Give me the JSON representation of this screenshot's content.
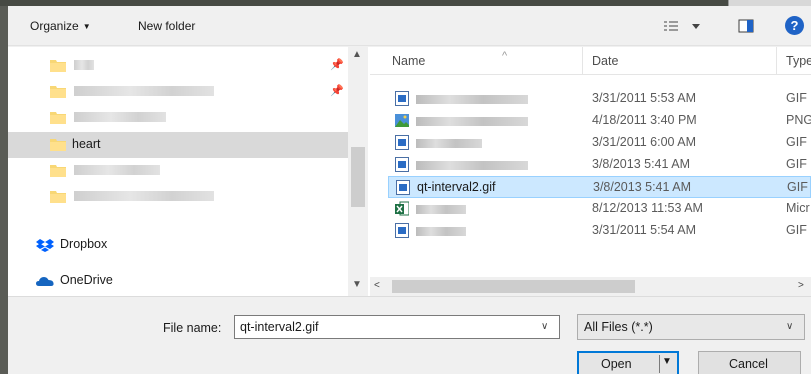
{
  "toolbar": {
    "organize_label": "Organize",
    "new_folder_label": "New folder",
    "help_label": "?"
  },
  "nav": {
    "selected_folder": "heart",
    "dropbox_label": "Dropbox",
    "onedrive_label": "OneDrive"
  },
  "columns": {
    "name": "Name",
    "date": "Date",
    "type": "Type"
  },
  "files": [
    {
      "name": "",
      "date": "3/31/2011 5:53 AM",
      "type": "GIF I",
      "icon": "gif-file-icon"
    },
    {
      "name": "",
      "date": "4/18/2011 3:40 PM",
      "type": "PNG",
      "icon": "png-file-icon"
    },
    {
      "name": "",
      "date": "3/31/2011 6:00 AM",
      "type": "GIF I",
      "icon": "gif-file-icon"
    },
    {
      "name": "",
      "date": "3/8/2013 5:41 AM",
      "type": "GIF I",
      "icon": "gif-file-icon"
    },
    {
      "name": "qt-interval2.gif",
      "date": "3/8/2013 5:41 AM",
      "type": "GIF I",
      "icon": "gif-file-icon",
      "selected": true
    },
    {
      "name": "",
      "date": "8/12/2013 11:53 AM",
      "type": "Micr",
      "icon": "excel-file-icon"
    },
    {
      "name": "",
      "date": "3/31/2011 5:54 AM",
      "type": "GIF I",
      "icon": "gif-file-icon"
    }
  ],
  "bottom": {
    "file_name_label": "File name:",
    "file_name_value": "qt-interval2.gif",
    "filter_value": "All Files (*.*)",
    "open_label": "Open",
    "cancel_label": "Cancel"
  },
  "colors": {
    "selection_bg": "#cce8ff",
    "selection_border": "#99d1ff",
    "folder_yellow": "#f8d775",
    "accent_blue": "#0078d7",
    "help_blue": "#1f63c6"
  }
}
